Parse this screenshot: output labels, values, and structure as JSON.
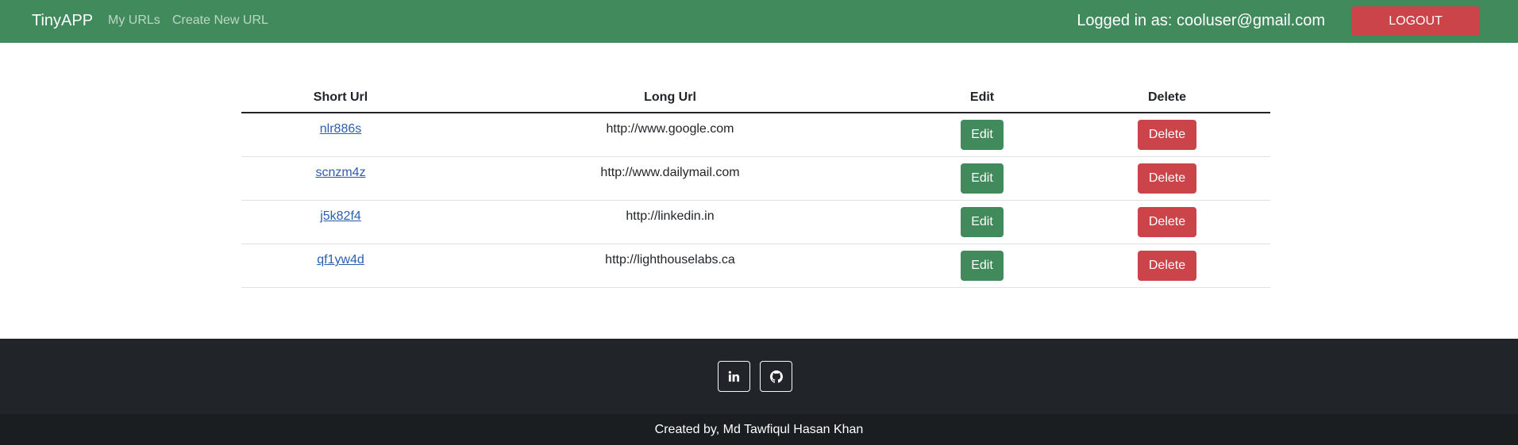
{
  "navbar": {
    "brand": "TinyAPP",
    "links": [
      "My URLs",
      "Create New URL"
    ],
    "logged_in_text": "Logged in as: cooluser@gmail.com",
    "logout_label": "LOGOUT"
  },
  "table": {
    "headers": [
      "Short Url",
      "Long Url",
      "Edit",
      "Delete"
    ],
    "rows": [
      {
        "short": "nlr886s",
        "long": "http://www.google.com",
        "edit": "Edit",
        "delete": "Delete"
      },
      {
        "short": "scnzm4z",
        "long": "http://www.dailymail.com",
        "edit": "Edit",
        "delete": "Delete"
      },
      {
        "short": "j5k82f4",
        "long": "http://linkedin.in",
        "edit": "Edit",
        "delete": "Delete"
      },
      {
        "short": "qf1yw4d",
        "long": "http://lighthouselabs.ca",
        "edit": "Edit",
        "delete": "Delete"
      }
    ]
  },
  "footer": {
    "social_icons": [
      "linkedin-icon",
      "github-icon"
    ],
    "credit": "Created by, Md Tawfiqul Hasan Khan"
  },
  "colors": {
    "navbar": "#408a5c",
    "edit_button": "#408a5c",
    "delete_button": "#cb444a",
    "footer": "#212529",
    "link": "#2a5fb0"
  }
}
